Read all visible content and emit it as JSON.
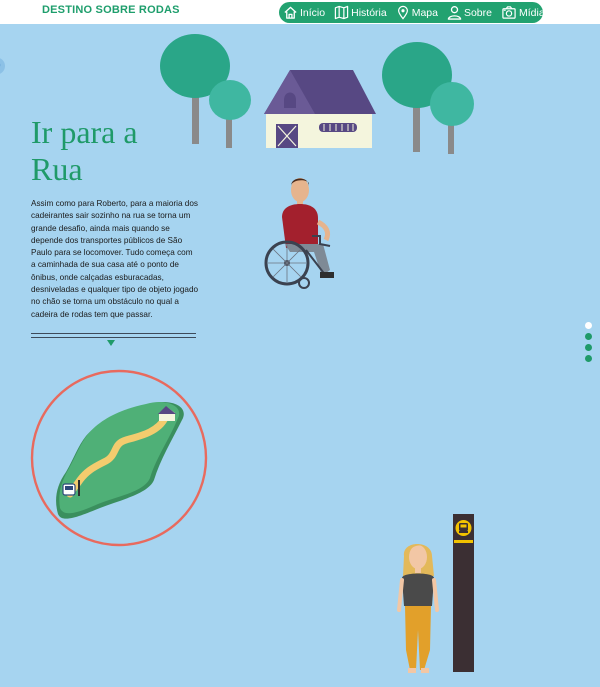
{
  "header": {
    "brand": "DESTINO SOBRE RODAS",
    "nav": [
      {
        "label": "Início",
        "icon": "home-icon"
      },
      {
        "label": "História",
        "icon": "map-book-icon"
      },
      {
        "label": "Mapa",
        "icon": "map-pin-icon"
      },
      {
        "label": "Sobre",
        "icon": "user-icon"
      },
      {
        "label": "Mídias",
        "icon": "camera-icon"
      }
    ]
  },
  "main": {
    "title_line1": "Ir para a",
    "title_line2": "Rua",
    "body": "Assim como para Roberto, para a maioria dos cadeirantes sair sozinho na rua se torna um grande desafio, ainda mais quando se depende dos transportes públicos de São Paulo para se locomover. Tudo começa com a caminhada de sua casa até o ponto de ônibus, onde calçadas esburacadas, desniveladas e qualquer tipo de objeto jogado no chão se torna um obstáculo no qual a cadeira de rodas tem que passar."
  },
  "pagination": {
    "count": 4,
    "active_index": 0
  },
  "colors": {
    "background": "#a6d4f0",
    "accent_green": "#1f9a69",
    "nav_green": "#22a270",
    "circle_red": "#e86a5e",
    "bus_stop_pole": "#3b2f33",
    "bus_stop_sign": "#f2c200"
  }
}
